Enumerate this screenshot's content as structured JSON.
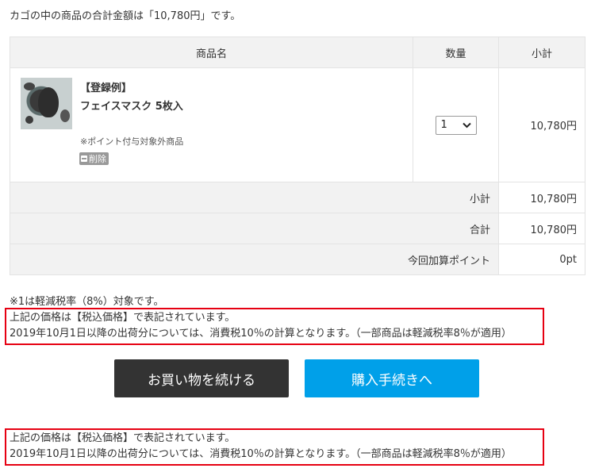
{
  "summary": "カゴの中の商品の合計金額は「10,780円」です。",
  "table": {
    "headers": [
      "商品名",
      "数量",
      "小計"
    ]
  },
  "item": {
    "tag": "【登録例】",
    "name": "フェイスマスク 5枚入",
    "note": "※ポイント付与対象外商品",
    "delete_label": "削除",
    "quantity": "1",
    "price": "10,780円"
  },
  "totals": {
    "subtotal_label": "小計",
    "subtotal_value": "10,780円",
    "total_label": "合計",
    "total_value": "10,780円",
    "points_label": "今回加算ポイント",
    "points_value": "0pt"
  },
  "tax_note": "※1は軽減税率（8%）対象です。",
  "notice": {
    "line1": "上記の価格は【税込価格】で表記されています。",
    "line2": "2019年10月1日以降の出荷分については、消費税10％の計算となります。（一部商品は軽減税率8％が適用）"
  },
  "buttons": {
    "continue": "お買い物を続ける",
    "checkout": "購入手続きへ"
  },
  "colors": {
    "notice_border": "#e60012",
    "continue_bg": "#333333",
    "checkout_bg": "#00a0e9"
  }
}
